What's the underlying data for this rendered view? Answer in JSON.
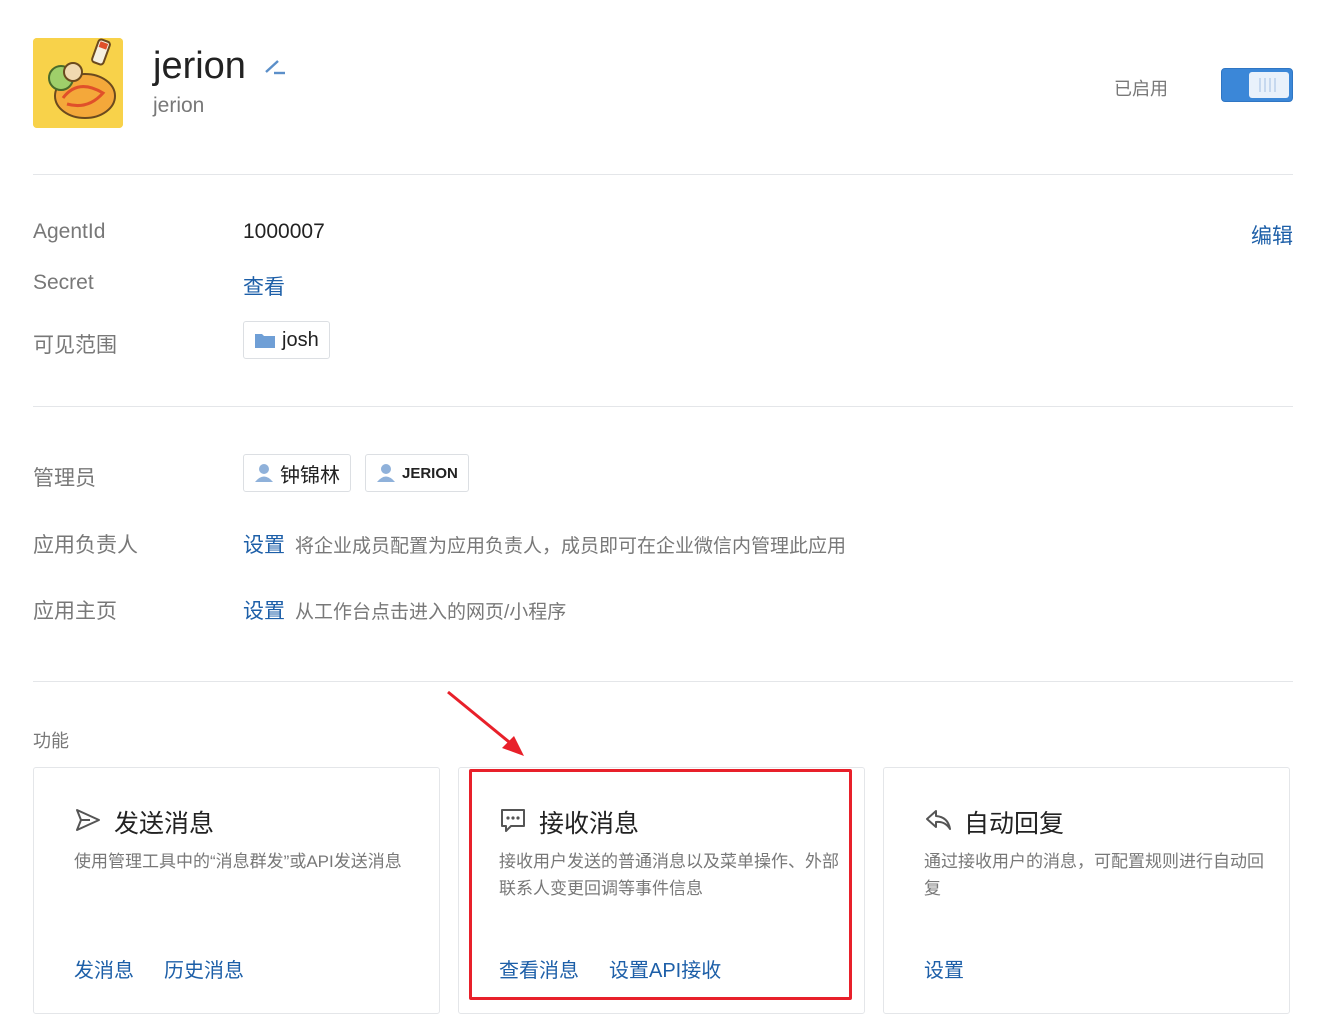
{
  "app": {
    "name": "jerion",
    "subtitle": "jerion",
    "status_label": "已启用",
    "enabled": true
  },
  "details": {
    "agentid_label": "AgentId",
    "agentid_value": "1000007",
    "edit_link": "编辑",
    "secret_label": "Secret",
    "secret_link": "查看",
    "visibility_label": "可见范围",
    "visibility_tag": "josh"
  },
  "admins": {
    "admin_label": "管理员",
    "admins": [
      "钟锦林",
      "JERION"
    ],
    "owner_label": "应用负责人",
    "owner_link": "设置",
    "owner_hint": "将企业成员配置为应用负责人，成员即可在企业微信内管理此应用",
    "homepage_label": "应用主页",
    "homepage_link": "设置",
    "homepage_hint": "从工作台点击进入的网页/小程序"
  },
  "features": {
    "section_title": "功能",
    "cards": [
      {
        "title": "发送消息",
        "desc": "使用管理工具中的“消息群发”或API发送消息",
        "links": [
          "发消息",
          "历史消息"
        ],
        "icon": "send-icon"
      },
      {
        "title": "接收消息",
        "desc": "接收用户发送的普通消息以及菜单操作、外部联系人变更回调等事件信息",
        "links": [
          "查看消息",
          "设置API接收"
        ],
        "icon": "chat-bubble-icon"
      },
      {
        "title": "自动回复",
        "desc": "通过接收用户的消息，可配置规则进行自动回复",
        "links": [
          "设置"
        ],
        "icon": "reply-icon"
      }
    ]
  },
  "colors": {
    "accent": "#1d5fa8",
    "toggle": "#3b87d8",
    "highlight": "#e8202a"
  }
}
